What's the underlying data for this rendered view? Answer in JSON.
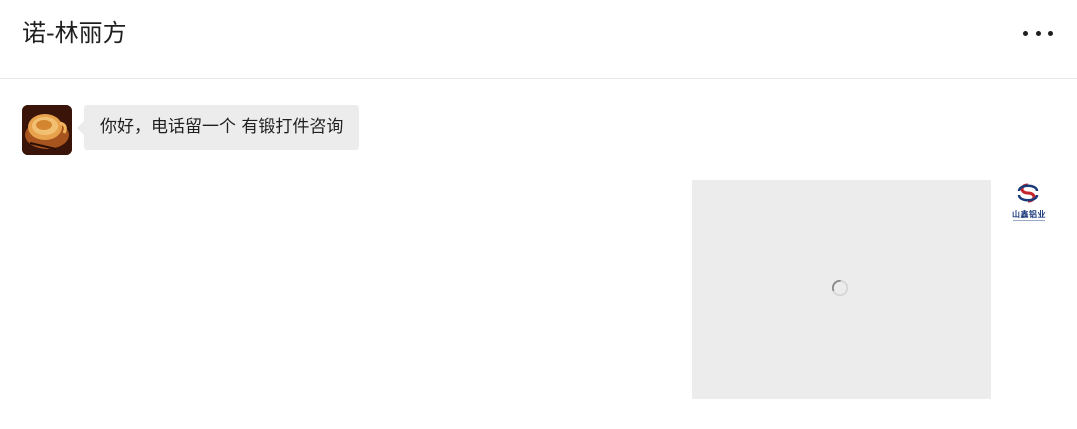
{
  "header": {
    "title": "诺-林丽方",
    "more_icon": "more-horizontal-icon"
  },
  "messages": [
    {
      "side": "left",
      "type": "text",
      "avatar_icon": "coffee-cup-avatar",
      "text": "你好，电话留一个 有锻打件咨询"
    },
    {
      "side": "right",
      "type": "image",
      "status": "loading",
      "spinner_icon": "loading-spinner-icon",
      "avatar_icon": "company-logo-avatar",
      "avatar_logo_text": "山鑫铝业"
    }
  ],
  "colors": {
    "bubble_bg": "#ececec",
    "header_border": "#e6e6e6",
    "logo_blue": "#1b3a7a",
    "logo_red": "#c8262e"
  }
}
